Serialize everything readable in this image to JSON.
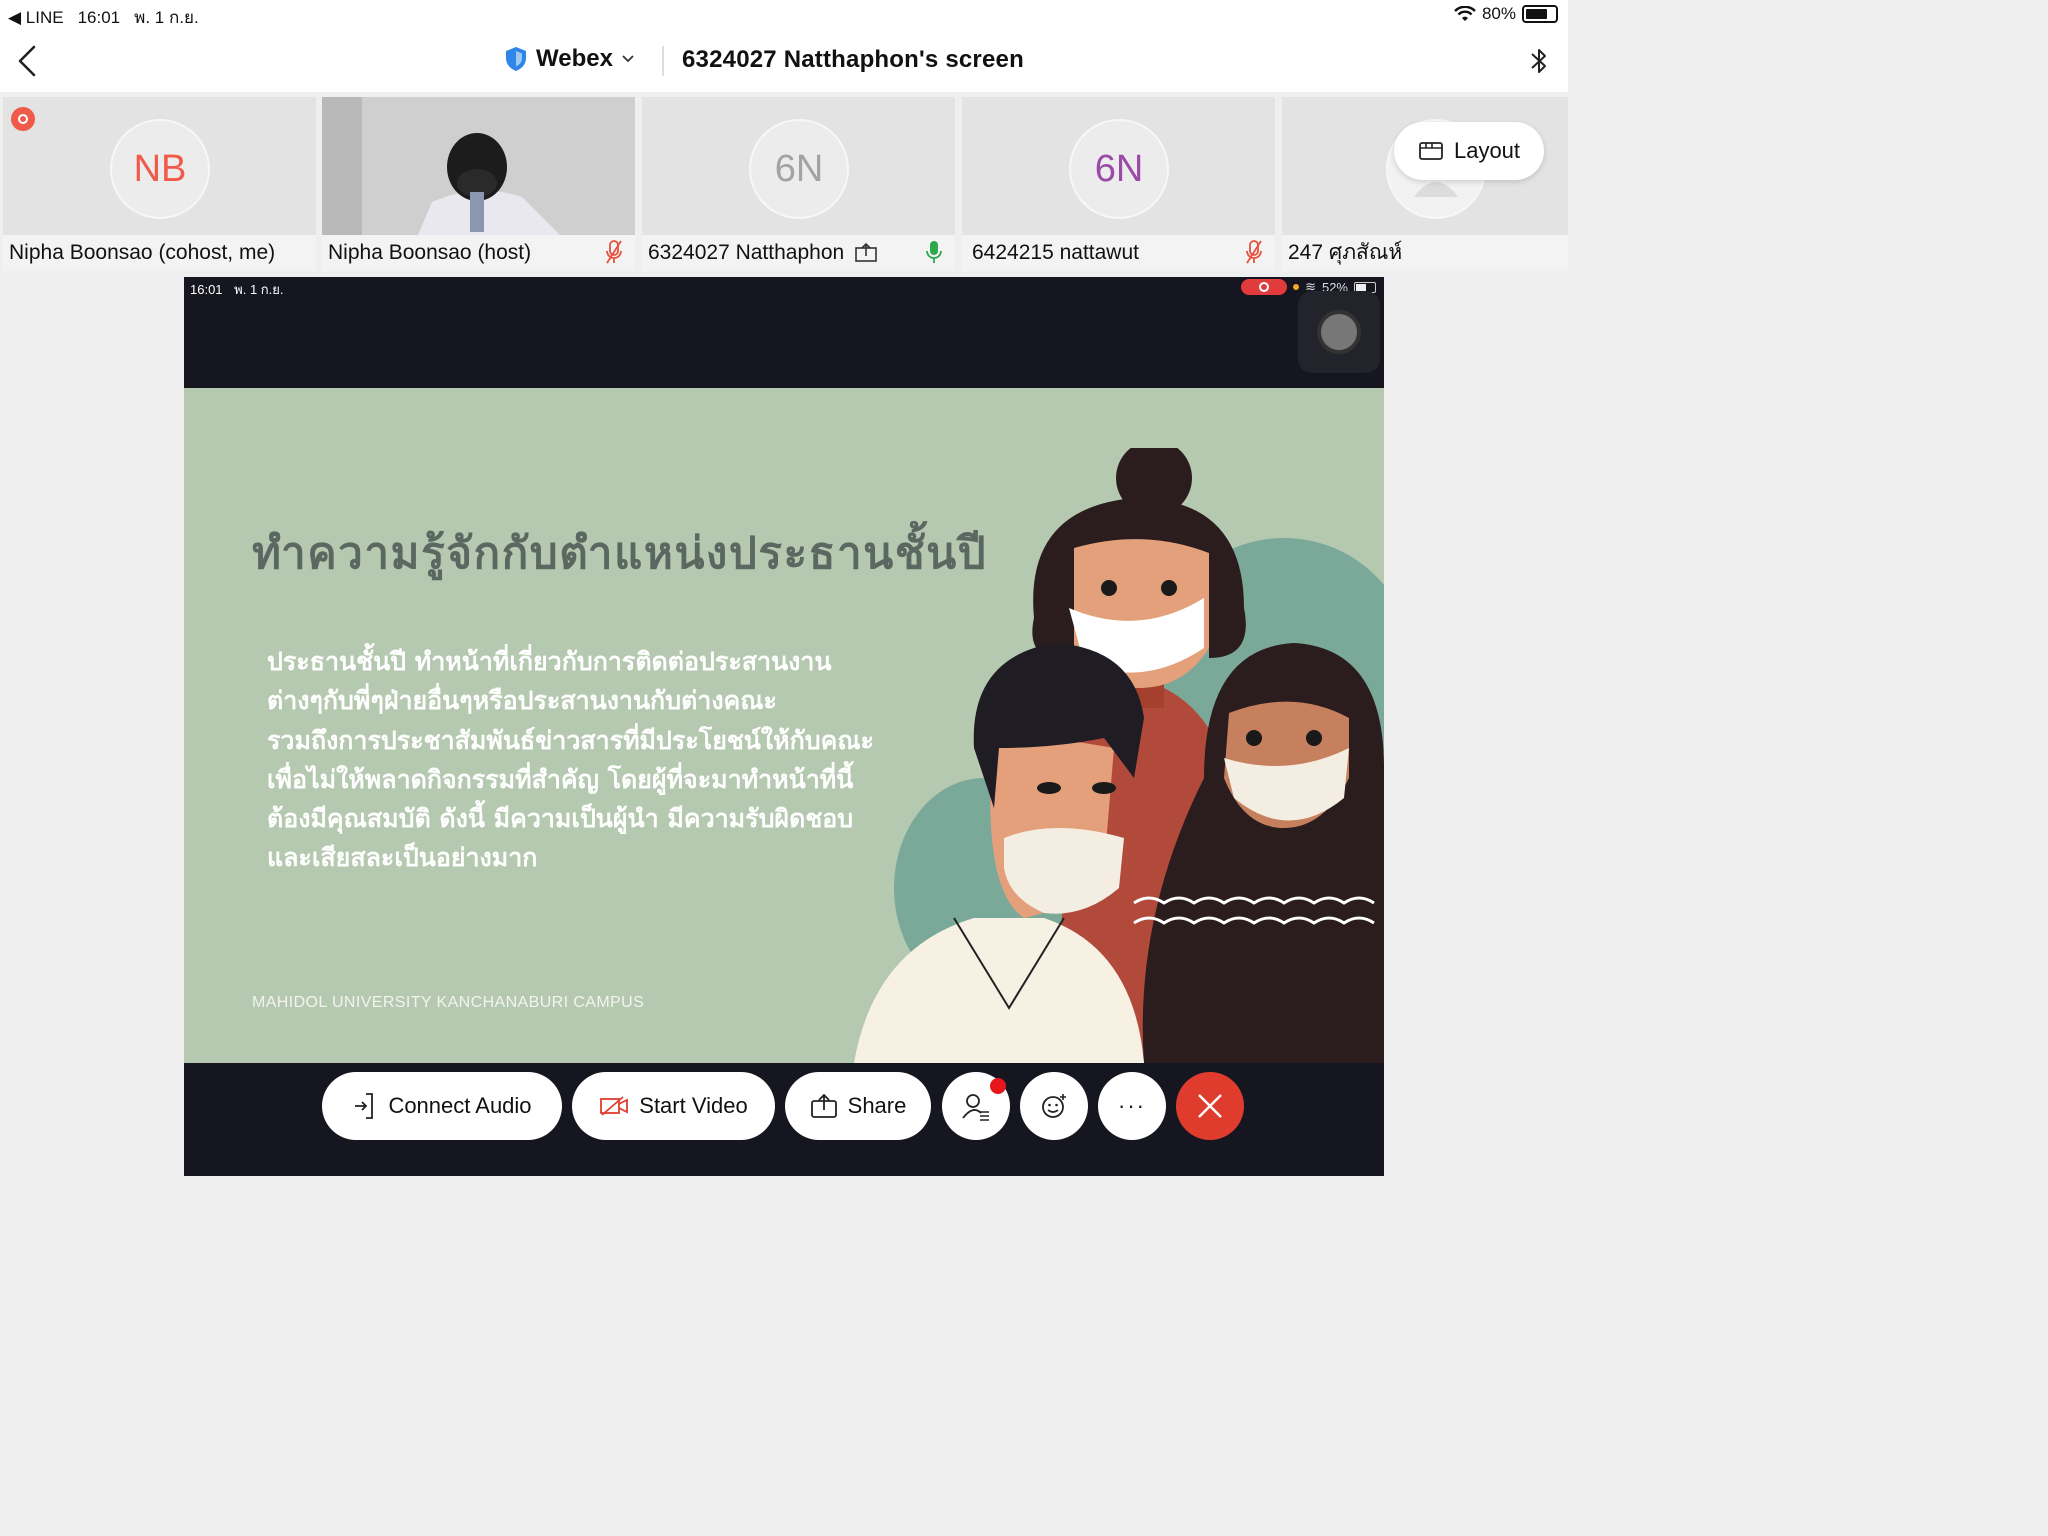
{
  "status_bar": {
    "back_app": "◀ LINE",
    "time": "16:01",
    "date": "พ. 1 ก.ย.",
    "battery_percent": "80%",
    "battery_level": 0.8
  },
  "header": {
    "app_name": "Webex",
    "title": "6324027 Natthaphon's screen"
  },
  "participants": [
    {
      "initials": "NB",
      "name": "Nipha Boonsao (cohost, me)",
      "initials_color": "#ef5a4b",
      "recording": true
    },
    {
      "initials": "",
      "name": "Nipha Boonsao (host)",
      "video": true,
      "status": "muted"
    },
    {
      "initials": "6N",
      "name": "6324027 Natthaphon",
      "initials_color": "#a3a3a3",
      "status": "speaking",
      "sharing": true
    },
    {
      "initials": "6N",
      "name": "6424215 nattawut",
      "initials_color": "#9b4aa8",
      "status": "muted"
    },
    {
      "initials": "",
      "name": "247 ศุภสัณห์",
      "status": "muted"
    }
  ],
  "layout_button": {
    "label": "Layout"
  },
  "shared_screen": {
    "time": "16:01",
    "date": "พ. 1 ก.ย.",
    "battery_percent": "52%",
    "slide": {
      "title": "ทำความรู้จักกับตำแหน่งประธานชั้นปี",
      "body_lines": [
        "ประธานชั้นปี ทำหน้าที่เกี่ยวกับการติดต่อประสานงาน",
        "ต่างๆกับพี่ๆฝ่ายอื่นๆหรือประสานงานกับต่างคณะ",
        "รวมถึงการประชาสัมพันธ์ข่าวสารที่มีประโยชน์ให้กับคณะ",
        "เพื่อไม่ให้พลาดกิจกรรมที่สำคัญ โดยผู้ที่จะมาทำหน้าที่นี้",
        "ต้องมีคุณสมบัติ ดังนี้ มีความเป็นผู้นำ มีความรับผิดชอบ",
        "และเสียสละเป็นอย่างมาก"
      ],
      "footer": "MAHIDOL UNIVERSITY KANCHANABURI CAMPUS",
      "background": "#b5c9b0"
    }
  },
  "controls": {
    "connect_audio": "Connect Audio",
    "start_video": "Start Video",
    "share": "Share",
    "more": "···"
  }
}
